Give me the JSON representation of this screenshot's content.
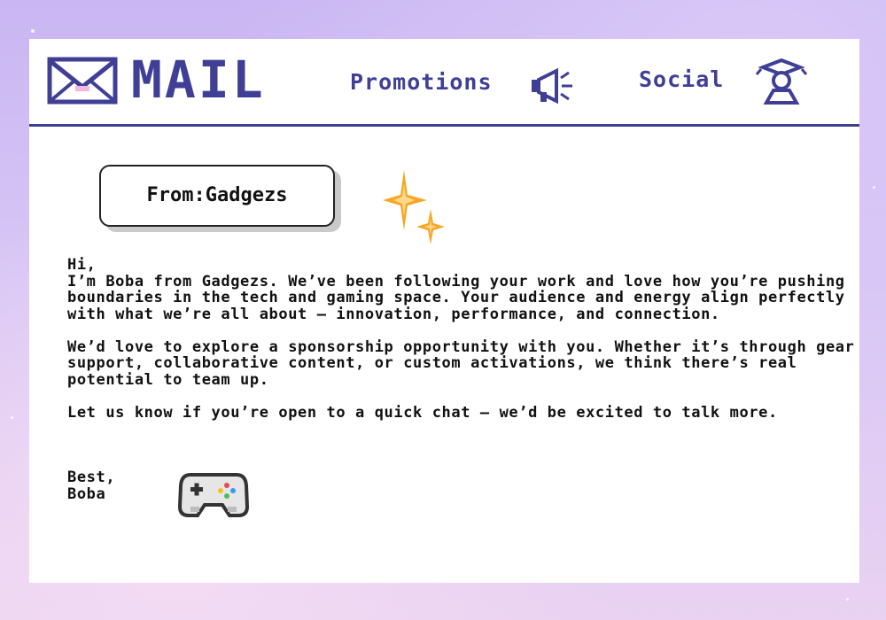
{
  "header": {
    "title": "MAIL",
    "tabs": [
      {
        "label": "Promotions",
        "icon": "megaphone-icon"
      },
      {
        "label": "Social",
        "icon": "person-icon"
      }
    ]
  },
  "email": {
    "from_label": "From:Gadgezs",
    "greeting": "Hi,",
    "paragraphs": [
      "I’m Boba from Gadgezs. We’ve been following your work and love how you’re pushing boundaries in the tech and gaming space. Your audience and energy align perfectly with what we’re all about — innovation, performance, and connection.",
      "We’d love to explore a sponsorship opportunity with you. Whether it’s through gear support, collaborative content, or custom activations, we think there’s real potential to team up.",
      "Let us know if you’re open to a quick chat — we’d be excited to talk more."
    ],
    "signoff": "Best,",
    "signature": "Boba"
  },
  "colors": {
    "accent": "#3f3f96",
    "sparkle": "#f6a623",
    "background_top": "#c9b6f3",
    "background_bottom": "#e9d2f2"
  }
}
